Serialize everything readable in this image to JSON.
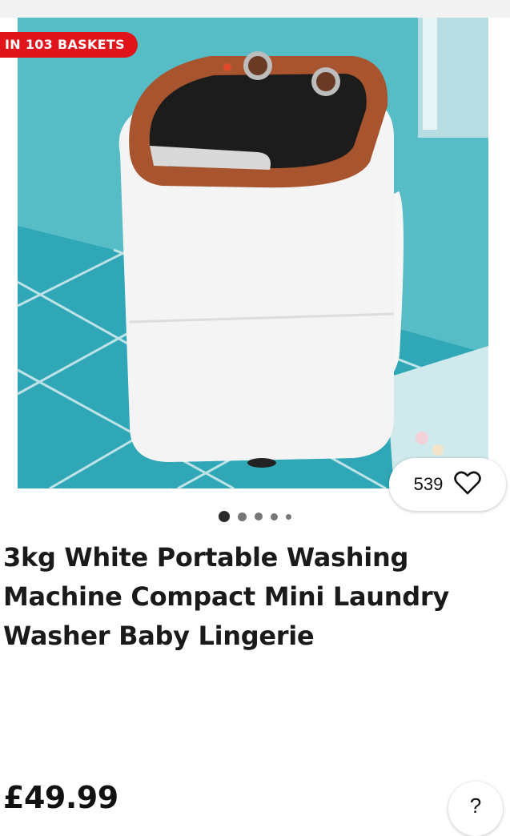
{
  "listing": {
    "baskets_badge": "IN 103 BASKETS",
    "watch_count": "539",
    "carousel_pages": 5,
    "carousel_active_index": 0,
    "title": "3kg White Portable Washing Machine Compact Mini Laundry Washer Baby Lingerie",
    "price": "£49.99",
    "help_label": "?"
  },
  "icons": {
    "watch": "heart-outline-icon",
    "help": "question-icon"
  },
  "colors": {
    "badge": "#e0151c",
    "background_scene": "#4fb5bf",
    "machine_lid_trim": "#a8552f"
  }
}
